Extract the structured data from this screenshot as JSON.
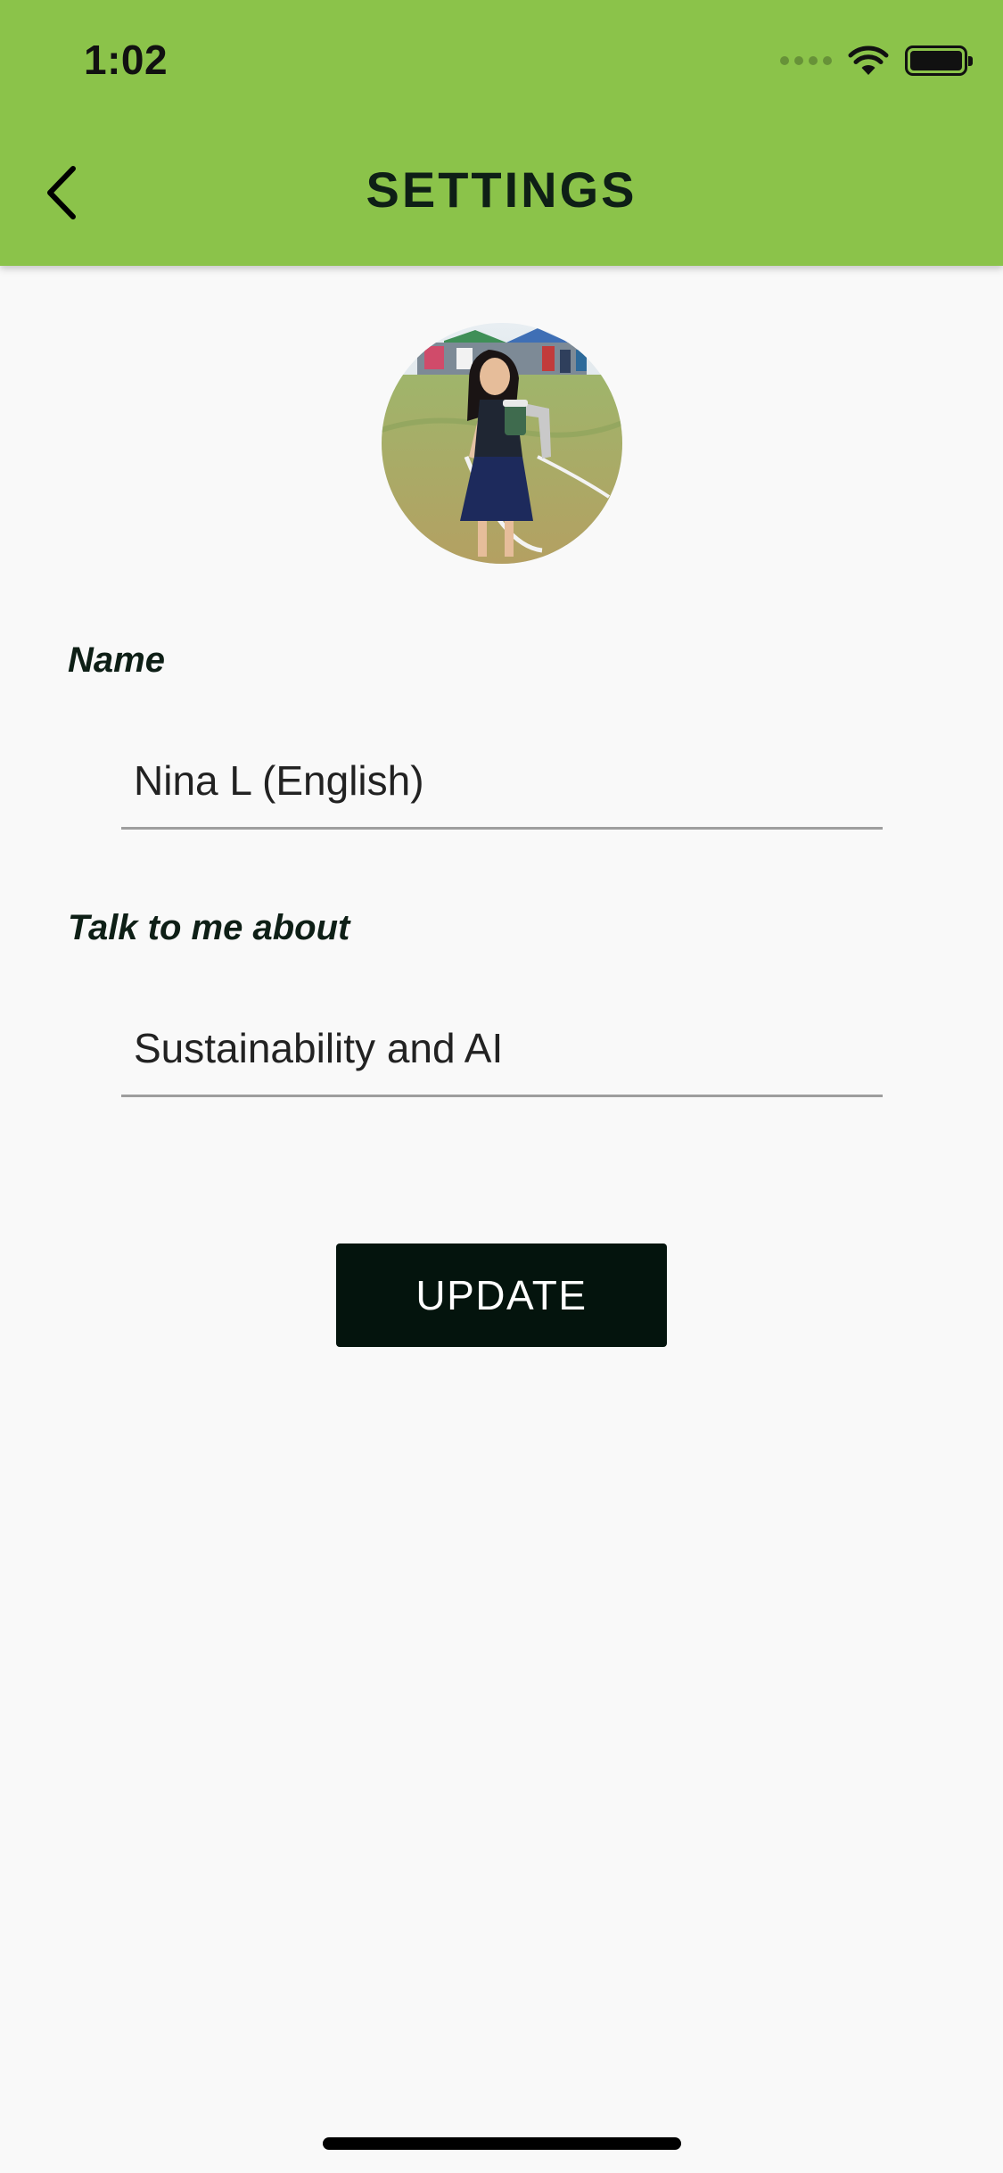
{
  "status_bar": {
    "time": "1:02"
  },
  "header": {
    "title": "SETTINGS",
    "back_icon": "chevron-left-icon",
    "background_color": "#8bc34a"
  },
  "profile": {
    "avatar_icon": "profile-photo"
  },
  "form": {
    "name_label": "Name",
    "name_value": "Nina L (English)",
    "topic_label": "Talk to me about",
    "topic_value": "Sustainability and AI",
    "update_label": "UPDATE"
  },
  "colors": {
    "accent": "#8bc34a",
    "button": "#04140d",
    "title_text": "#0e1f16",
    "underline": "#9e9e9e"
  }
}
